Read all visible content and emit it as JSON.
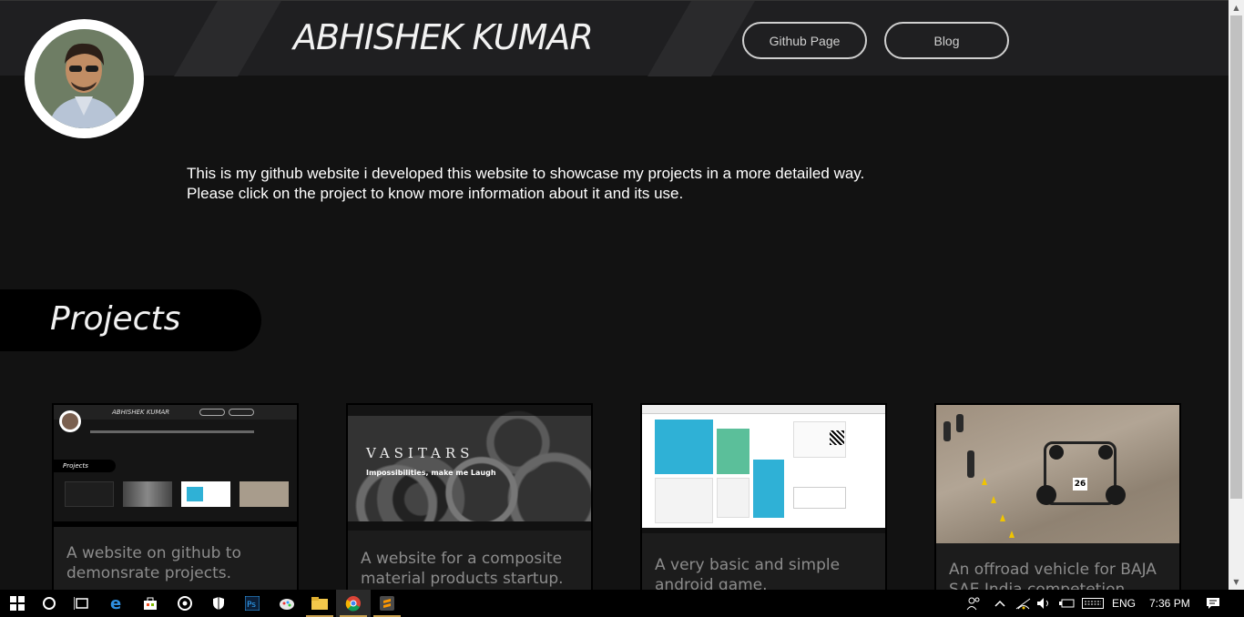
{
  "header": {
    "title": "ABHISHEK KUMAR",
    "buttons": [
      "Github Page",
      "Blog"
    ]
  },
  "intro": {
    "line1": "This is my github website i developed this website to showcase my projects in a more detailed way.",
    "line2": "Please click on the project to know more information about it and its use."
  },
  "projects": {
    "heading": "Projects",
    "cards": [
      {
        "desc1": "A website on github to",
        "desc2": "demonsrate projects."
      },
      {
        "desc1": "A website for a composite",
        "desc2": "material products startup."
      },
      {
        "desc1": "A very basic and simple",
        "desc2": "android game."
      },
      {
        "desc1": "An offroad vehicle for BAJA",
        "desc2": "SAE India competetion."
      }
    ],
    "thumb1": {
      "title": "ABHISHEK KUMAR",
      "heading": "Projects"
    },
    "thumb2": {
      "logo": "VASITARS",
      "tagline": "Impossibilities, make me Laugh"
    },
    "thumb4": {
      "number": "26"
    }
  },
  "taskbar": {
    "language": "ENG",
    "time": "7:36 PM"
  }
}
